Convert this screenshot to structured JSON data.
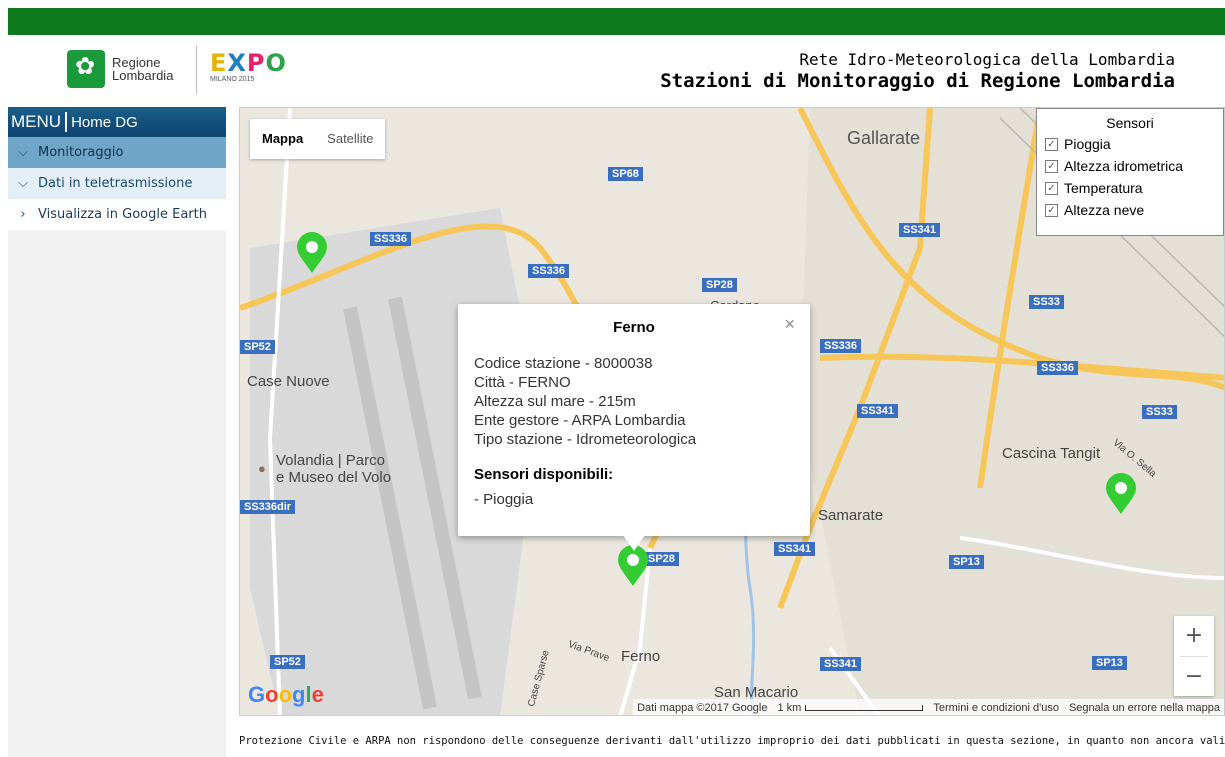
{
  "header": {
    "logo_region_line1": "Regione",
    "logo_region_line2": "Lombardia",
    "logo_expo": "EXPO",
    "logo_expo_sub": "MILANO 2015",
    "title_line1": "Rete Idro-Meteorologica della Lombardia",
    "title_line2": "Stazioni di Monitoraggio di Regione Lombardia",
    "bar_color": "#0f7a1d"
  },
  "sidebar": {
    "menu_label": "MENU",
    "home_label": "Home DG",
    "items": [
      {
        "label": "Monitoraggio",
        "icon": "chevron-down-icon"
      },
      {
        "label": "Dati in teletrasmissione",
        "icon": "chevron-down-icon"
      },
      {
        "label": "Visualizza in Google Earth",
        "icon": "chevron-right-icon"
      }
    ]
  },
  "map": {
    "type_buttons": [
      "Mappa",
      "Satellite"
    ],
    "active_type": "Mappa",
    "sensors_panel": {
      "title": "Sensori",
      "items": [
        "Pioggia",
        "Altezza idrometrica",
        "Temperatura",
        "Altezza neve"
      ]
    },
    "place_labels": [
      "Gallarate",
      "Case Nuove",
      "Volandia | Parco",
      "e Museo del Volo",
      "Cascina Tangit",
      "Samarate",
      "Ferno",
      "San Macario",
      "Cardano",
      "Via Prave",
      "Case Sparse",
      "Via O. Sella"
    ],
    "road_labels": [
      "SP68",
      "SS336",
      "SS336",
      "SP28",
      "SS341",
      "SS33",
      "SP52",
      "SS336",
      "SS336",
      "SS341",
      "SS33",
      "SS336dir",
      "SS341",
      "SP28",
      "SP13",
      "SP52",
      "SS341",
      "SP13"
    ],
    "popup": {
      "title": "Ferno",
      "close": "×",
      "lines": [
        "Codice stazione - 8000038",
        "Città - FERNO",
        "Altezza sul mare - 215m",
        "Ente gestore - ARPA Lombardia",
        "Tipo stazione - Idrometeorologica"
      ],
      "sensors_heading": "Sensori disponibili:",
      "sensors": [
        "- Pioggia"
      ]
    },
    "zoom_in": "+",
    "zoom_out": "−",
    "brand": "Google",
    "attribution": {
      "data": "Dati mappa ©2017 Google",
      "scale": "1 km",
      "terms": "Termini e condizioni d'uso",
      "report": "Segnala un errore nella mappa"
    },
    "marker_color": "#33cc33"
  },
  "footer": {
    "text": "Protezione Civile e ARPA non rispondono delle conseguenze derivanti dall'utilizzo improprio dei dati pubblicati in questa sezione, in quanto non ancora validati."
  }
}
